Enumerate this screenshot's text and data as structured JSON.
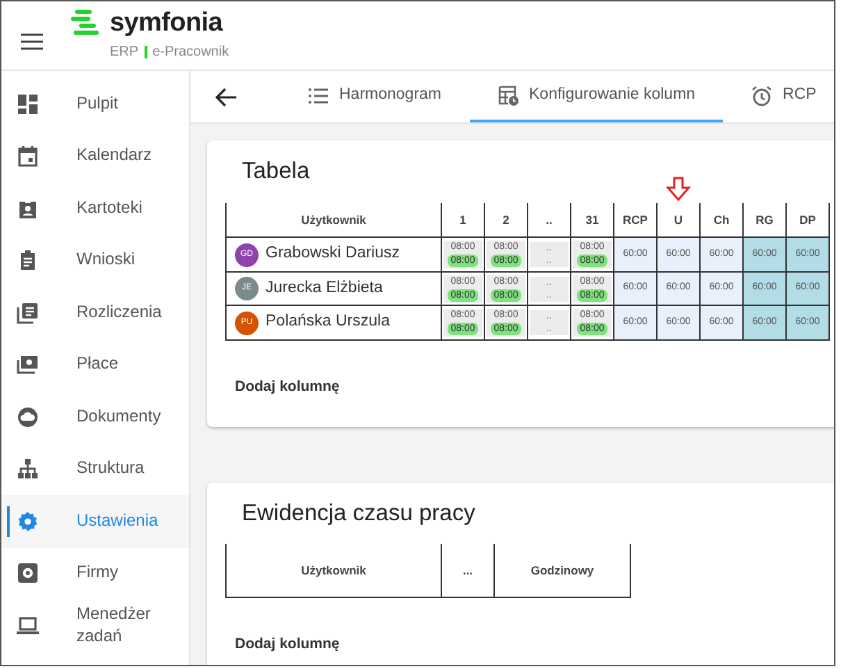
{
  "header": {
    "logo_text": "symfonia",
    "product": "ERP",
    "module": "e-Pracownik"
  },
  "sidebar": {
    "items": [
      {
        "label": "Pulpit",
        "selected": false
      },
      {
        "label": "Kalendarz",
        "selected": false
      },
      {
        "label": "Kartoteki",
        "selected": false
      },
      {
        "label": "Wnioski",
        "selected": false
      },
      {
        "label": "Rozliczenia",
        "selected": false
      },
      {
        "label": "Płace",
        "selected": false
      },
      {
        "label": "Dokumenty",
        "selected": false
      },
      {
        "label": "Struktura",
        "selected": false
      },
      {
        "label": "Ustawienia",
        "selected": true
      },
      {
        "label": "Firmy",
        "selected": false
      },
      {
        "label": "Menedżer zadań",
        "selected": false
      }
    ]
  },
  "tabs": [
    {
      "label": "Harmonogram",
      "selected": false
    },
    {
      "label": "Konfigurowanie kolumn",
      "selected": true
    },
    {
      "label": "RCP",
      "selected": false
    }
  ],
  "sections": [
    {
      "title": "Tabela",
      "columns": [
        {
          "label": "Użytkownik",
          "kind": "user",
          "marked": false
        },
        {
          "label": "1",
          "kind": "day",
          "marked": false
        },
        {
          "label": "2",
          "kind": "day",
          "marked": false
        },
        {
          "label": "..",
          "kind": "gap",
          "marked": false
        },
        {
          "label": "31",
          "kind": "day",
          "marked": false
        },
        {
          "label": "RCP",
          "kind": "sum",
          "marked": false
        },
        {
          "label": "U",
          "kind": "sum",
          "marked": true
        },
        {
          "label": "Ch",
          "kind": "sum",
          "marked": false
        },
        {
          "label": "RG",
          "kind": "sum-dark",
          "marked": false
        },
        {
          "label": "DP",
          "kind": "sum-dark",
          "marked": false
        }
      ],
      "rows": [
        {
          "cells": [
            {
              "initials": "GD",
              "name": "Grabowski Dariusz",
              "color": "#8e44ad"
            },
            {
              "top": "08:00",
              "bottom": "08:00"
            },
            {
              "top": "08:00",
              "bottom": "08:00"
            },
            {
              "top": "..",
              "bottom": ".."
            },
            {
              "top": "08:00",
              "bottom": "08:00"
            },
            {
              "value": "60:00"
            },
            {
              "value": "60:00"
            },
            {
              "value": "60:00"
            },
            {
              "value": "60:00"
            },
            {
              "value": "60:00"
            }
          ]
        },
        {
          "cells": [
            {
              "initials": "JE",
              "name": "Jurecka Elżbieta",
              "color": "#7b8a8b"
            },
            {
              "top": "08:00",
              "bottom": "08:00"
            },
            {
              "top": "08:00",
              "bottom": "08:00"
            },
            {
              "top": "..",
              "bottom": ".."
            },
            {
              "top": "08:00",
              "bottom": "08:00"
            },
            {
              "value": "60:00"
            },
            {
              "value": "60:00"
            },
            {
              "value": "60:00"
            },
            {
              "value": "60:00"
            },
            {
              "value": "60:00"
            }
          ]
        },
        {
          "cells": [
            {
              "initials": "PU",
              "name": "Polańska Urszula",
              "color": "#d35400"
            },
            {
              "top": "08:00",
              "bottom": "08:00"
            },
            {
              "top": "08:00",
              "bottom": "08:00"
            },
            {
              "top": "..",
              "bottom": ".."
            },
            {
              "top": "08:00",
              "bottom": "08:00"
            },
            {
              "value": "60:00"
            },
            {
              "value": "60:00"
            },
            {
              "value": "60:00"
            },
            {
              "value": "60:00"
            },
            {
              "value": "60:00"
            }
          ]
        }
      ],
      "add_label": "Dodaj kolumnę"
    },
    {
      "title": "Ewidencja czasu pracy",
      "columns": [
        {
          "label": "Użytkownik",
          "kind": "user",
          "marked": false
        },
        {
          "label": "...",
          "kind": "gap-wide",
          "marked": false
        },
        {
          "label": "Godzinowy",
          "kind": "wide",
          "marked": false
        }
      ],
      "add_label": "Dodaj kolumnę"
    }
  ]
}
